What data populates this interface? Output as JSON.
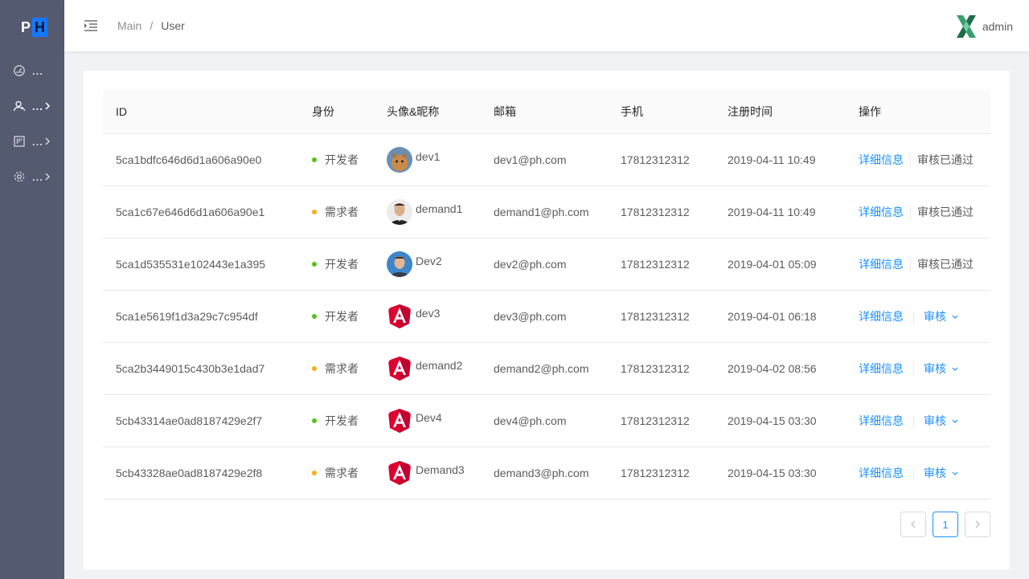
{
  "logo": {
    "p": "P",
    "h": "H"
  },
  "sidebar": {
    "items": [
      {
        "label": "...",
        "icon": "dashboard-icon"
      },
      {
        "label": "...",
        "icon": "users-icon",
        "active": true
      },
      {
        "label": "...",
        "icon": "board-icon"
      },
      {
        "label": "...",
        "icon": "settings-icon"
      }
    ]
  },
  "header": {
    "breadcrumb": [
      "Main",
      "User"
    ],
    "separator": "/",
    "username": "admin"
  },
  "table": {
    "columns": [
      "ID",
      "身份",
      "头像&昵称",
      "邮箱",
      "手机",
      "注册时间",
      "操作"
    ],
    "rows": [
      {
        "id": "5ca1bdfc646d6d1a606a90e0",
        "role": "开发者",
        "role_color": "#52c41a",
        "avatar": "cat",
        "nick": "dev1",
        "email": "dev1@ph.com",
        "phone": "17812312312",
        "time": "2019-04-11 10:49",
        "detail": "详细信息",
        "action": "审核已通过",
        "approved": true
      },
      {
        "id": "5ca1c67e646d6d1a606a90e1",
        "role": "需求者",
        "role_color": "#faad14",
        "avatar": "man",
        "nick": "demand1",
        "email": "demand1@ph.com",
        "phone": "17812312312",
        "time": "2019-04-11 10:49",
        "detail": "详细信息",
        "action": "审核已通过",
        "approved": true
      },
      {
        "id": "5ca1d535531e102443e1a395",
        "role": "开发者",
        "role_color": "#52c41a",
        "avatar": "person",
        "nick": "Dev2",
        "email": "dev2@ph.com",
        "phone": "17812312312",
        "time": "2019-04-01 05:09",
        "detail": "详细信息",
        "action": "审核已通过",
        "approved": true
      },
      {
        "id": "5ca1e5619f1d3a29c7c954df",
        "role": "开发者",
        "role_color": "#52c41a",
        "avatar": "angular",
        "nick": "dev3",
        "email": "dev3@ph.com",
        "phone": "17812312312",
        "time": "2019-04-01 06:18",
        "detail": "详细信息",
        "action": "审核",
        "approved": false
      },
      {
        "id": "5ca2b3449015c430b3e1dad7",
        "role": "需求者",
        "role_color": "#faad14",
        "avatar": "angular",
        "nick": "demand2",
        "email": "demand2@ph.com",
        "phone": "17812312312",
        "time": "2019-04-02 08:56",
        "detail": "详细信息",
        "action": "审核",
        "approved": false
      },
      {
        "id": "5cb43314ae0ad8187429e2f7",
        "role": "开发者",
        "role_color": "#52c41a",
        "avatar": "angular",
        "nick": "Dev4",
        "email": "dev4@ph.com",
        "phone": "17812312312",
        "time": "2019-04-15 03:30",
        "detail": "详细信息",
        "action": "审核",
        "approved": false
      },
      {
        "id": "5cb43328ae0ad8187429e2f8",
        "role": "需求者",
        "role_color": "#faad14",
        "avatar": "angular",
        "nick": "Demand3",
        "email": "demand3@ph.com",
        "phone": "17812312312",
        "time": "2019-04-15 03:30",
        "detail": "详细信息",
        "action": "审核",
        "approved": false
      }
    ]
  },
  "pagination": {
    "current": "1",
    "prev_icon": "chevron-left-icon",
    "next_icon": "chevron-right-icon"
  },
  "colors": {
    "primary": "#1890ff",
    "sidebar": "#545a70",
    "developer": "#52c41a",
    "demander": "#faad14"
  }
}
